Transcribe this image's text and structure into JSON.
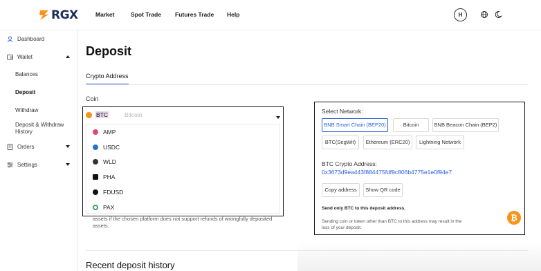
{
  "header": {
    "logo_text": "RGX",
    "nav": [
      "Market",
      "Spot Trade",
      "Futures Trade",
      "Help"
    ],
    "avatar_initial": "H"
  },
  "sidebar": {
    "items": [
      {
        "label": "Dashboard",
        "icon": "user-icon"
      },
      {
        "label": "Wallet",
        "icon": "wallet-icon",
        "expanded": true
      },
      {
        "label": "Orders",
        "icon": "orders-icon",
        "expanded": false
      },
      {
        "label": "Settings",
        "icon": "settings-icon",
        "expanded": false
      }
    ],
    "wallet_sub": [
      "Balances",
      "Deposit",
      "Withdraw",
      "Deposit & Withdraw",
      "History"
    ],
    "active_sub": "Deposit"
  },
  "page": {
    "title": "Deposit",
    "tab": "Crypto Address",
    "coin_label": "Coin",
    "selected_coin": "BTC",
    "coin_placeholder": "Bitcoin",
    "coin_options": [
      {
        "symbol": "AMP",
        "color": "#e0457b"
      },
      {
        "symbol": "USDC",
        "color": "#2775ca"
      },
      {
        "symbol": "WLD",
        "color": "#333333"
      },
      {
        "symbol": "PHA",
        "color": "#111111"
      },
      {
        "symbol": "FDUSD",
        "color": "#111111"
      },
      {
        "symbol": "PAX",
        "color": "#3aa852"
      }
    ],
    "note_line1": "assets if the chosen platform does not support refunds of wrongfully deposited",
    "note_line2": "assets.",
    "recent_title": "Recent deposit history"
  },
  "network": {
    "label": "Select Network:",
    "buttons": [
      "BNB Smart Chain (BEP20)",
      "Bitcoin",
      "BNB Beacon Chain (BEP2)",
      "BTC(SegWit)",
      "Ethereum (ERC20)",
      "Lightning Network"
    ],
    "active": "BNB Smart Chain (BEP20)",
    "address_label": "BTC Crypto Address:",
    "address": "0x3673d9ea443f884475fdf9c806b4775e1e0f94e7",
    "copy_label": "Copy address",
    "qr_label": "Show QR code",
    "warning_bold": "Send only BTC to this deposit address.",
    "warning_text": "Sending coin or token other than BTC to this address may result in the loss of your deposit.",
    "accent": "#2b5fd9",
    "btc_color": "#f7931a"
  }
}
